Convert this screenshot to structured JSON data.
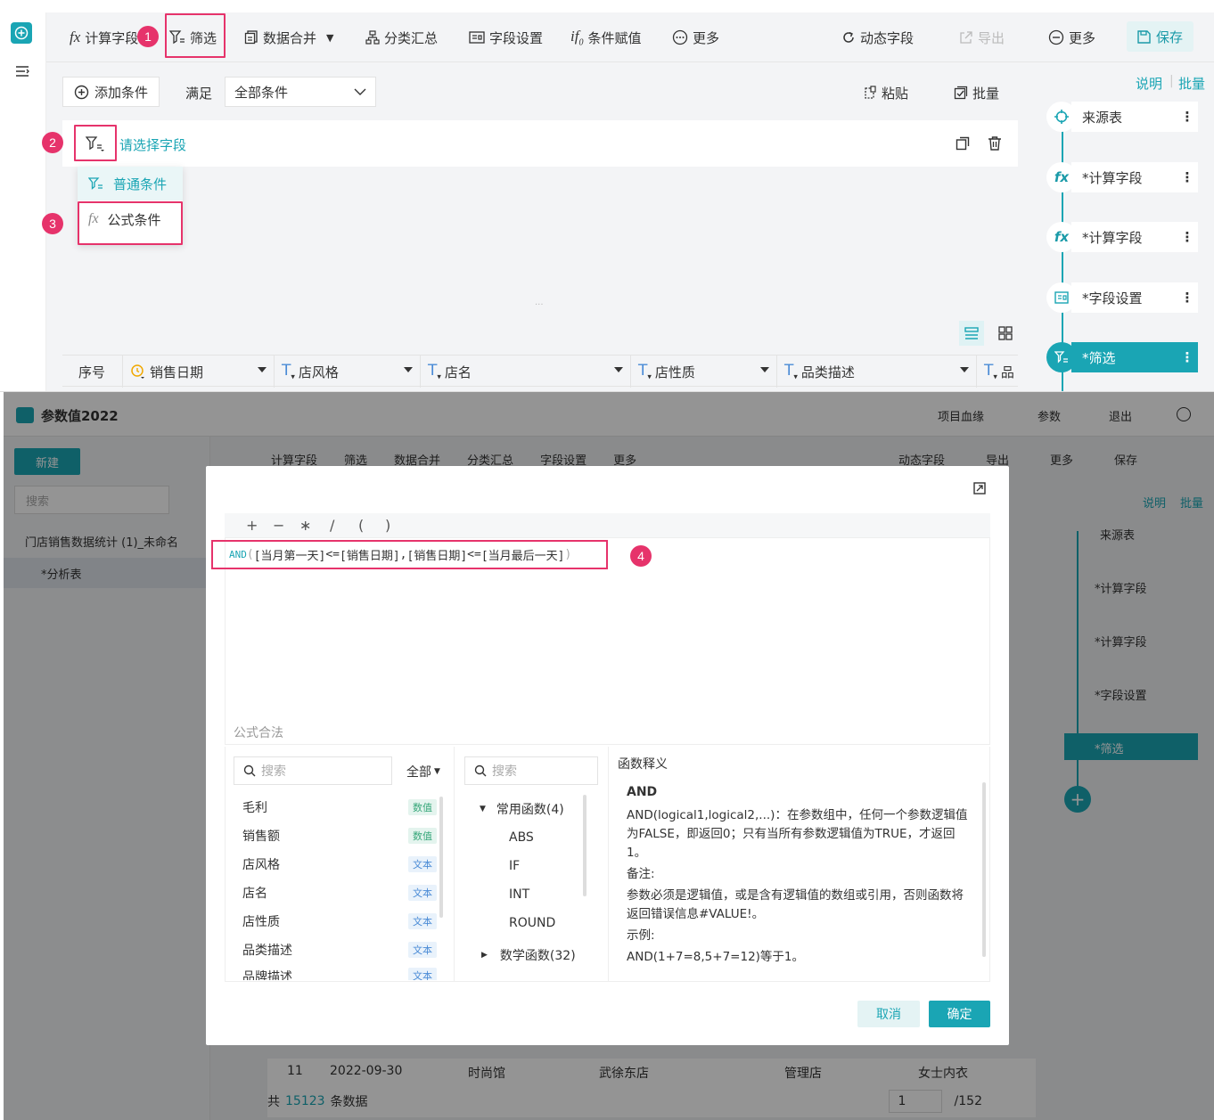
{
  "toolbar": {
    "calc_field": "计算字段",
    "filter": "筛选",
    "data_merge": "数据合并",
    "group_summary": "分类汇总",
    "field_settings": "字段设置",
    "cond_assign": "条件赋值",
    "more": "更多",
    "dynamic_field": "动态字段",
    "export": "导出",
    "more2": "更多",
    "save": "保存"
  },
  "filter_panel": {
    "add_condition": "添加条件",
    "satisfy": "满足",
    "all_conditions": "全部条件",
    "paste": "粘贴",
    "batch": "批量",
    "select_field": "请选择字段",
    "dots": "...",
    "menu": [
      "普通条件",
      "公式条件"
    ]
  },
  "table": {
    "columns": [
      "序号",
      "销售日期",
      "店风格",
      "店名",
      "店性质",
      "品类描述",
      "品"
    ]
  },
  "side_panel": {
    "links": [
      "说明",
      "批量"
    ],
    "nodes": [
      "来源表",
      "*计算字段",
      "*计算字段",
      "*字段设置",
      "*筛选"
    ]
  },
  "steps": [
    "1",
    "2",
    "3",
    "4"
  ],
  "bottom": {
    "title": "参数值2022",
    "lineage": "项目血缘",
    "params": "参数",
    "exit": "退出",
    "new": "新建",
    "search": "搜索",
    "tree": [
      "门店销售数据统计 (1)_未命名",
      "*分析表"
    ],
    "toolbar": [
      "计算字段",
      "筛选",
      "数据合并",
      "分类汇总",
      "字段设置",
      "更多",
      "动态字段",
      "导出",
      "更多",
      "保存"
    ],
    "links": [
      "说明",
      "批量"
    ],
    "nodes": [
      "来源表",
      "*计算字段",
      "*计算字段",
      "*字段设置",
      "*筛选"
    ],
    "rows": [
      {
        "no": "11",
        "date": "2022-09-30",
        "style": "时尚馆",
        "store": "武徐东店",
        "nature": "管理店",
        "category": "女士内衣"
      }
    ],
    "footer": {
      "prefix": "共",
      "count": "15123",
      "suffix": "条数据",
      "page": "1",
      "total": "/152"
    }
  },
  "modal": {
    "ops": [
      "+",
      "−",
      "∗",
      "/",
      "(",
      ")"
    ],
    "formula_parts": {
      "and": "AND",
      "p1": "(",
      "f1": "[当月第一天]",
      "op1": "<=",
      "f2": "[销售日期]",
      "comma": ",",
      "f3": "[销售日期]",
      "op2": "<=",
      "f4": "[当月最后一天]",
      "p2": ")"
    },
    "valid_text": "公式合法",
    "field_search": "搜索",
    "all_label": "全部",
    "fields": [
      {
        "name": "毛利",
        "type": "数值"
      },
      {
        "name": "销售额",
        "type": "数值"
      },
      {
        "name": "店风格",
        "type": "文本"
      },
      {
        "name": "店名",
        "type": "文本"
      },
      {
        "name": "店性质",
        "type": "文本"
      },
      {
        "name": "品类描述",
        "type": "文本"
      },
      {
        "name": "品牌描述",
        "type": "文本"
      }
    ],
    "func_search": "搜索",
    "func_group1": "常用函数(4)",
    "funcs": [
      "ABS",
      "IF",
      "INT",
      "ROUND"
    ],
    "func_group2": "数学函数(32)",
    "desc_title": "函数释义",
    "desc_name": "AND",
    "desc_body": "AND(logical1,logical2,...)：在参数组中，任何一个参数逻辑值为FALSE，即返回0；只有当所有参数逻辑值为TRUE，才返回1。",
    "desc_note_label": "备注:",
    "desc_note": "参数必须是逻辑值，或是含有逻辑值的数组或引用，否则函数将返回错误信息#VALUE!。",
    "desc_example_label": "示例:",
    "desc_example": "AND(1+7=8,5+7=12)等于1。",
    "cancel": "取消",
    "confirm": "确定"
  },
  "colors": {
    "accent": "#1aa5b4",
    "highlight": "#e6336b"
  }
}
